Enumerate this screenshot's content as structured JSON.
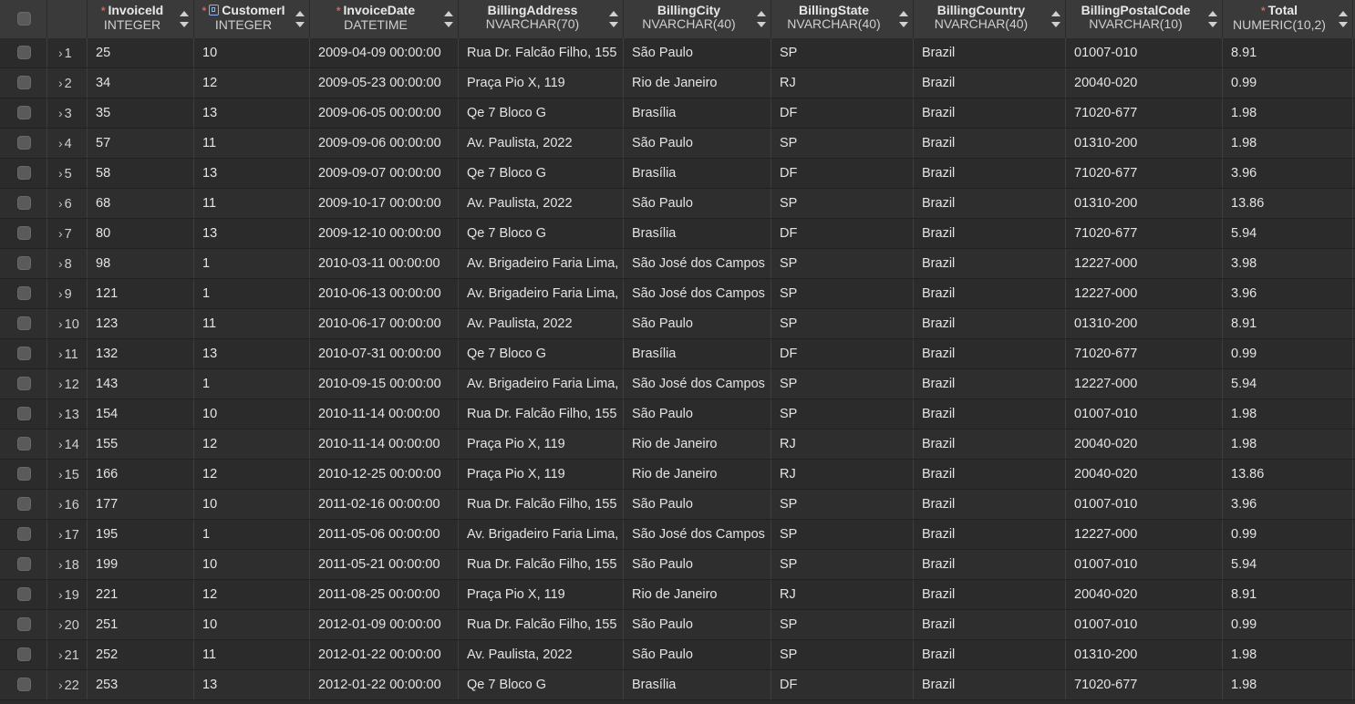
{
  "columns": [
    {
      "name": "InvoiceId",
      "type": "INTEGER",
      "required": true,
      "key": false
    },
    {
      "name": "CustomerI",
      "type": "INTEGER",
      "required": true,
      "key": true
    },
    {
      "name": "InvoiceDate",
      "type": "DATETIME",
      "required": true,
      "key": false
    },
    {
      "name": "BillingAddress",
      "type": "NVARCHAR(70)",
      "required": false,
      "key": false
    },
    {
      "name": "BillingCity",
      "type": "NVARCHAR(40)",
      "required": false,
      "key": false
    },
    {
      "name": "BillingState",
      "type": "NVARCHAR(40)",
      "required": false,
      "key": false
    },
    {
      "name": "BillingCountry",
      "type": "NVARCHAR(40)",
      "required": false,
      "key": false
    },
    {
      "name": "BillingPostalCode",
      "type": "NVARCHAR(10)",
      "required": false,
      "key": false
    },
    {
      "name": "Total",
      "type": "NUMERIC(10,2)",
      "required": true,
      "key": false
    }
  ],
  "required_marker": "*",
  "rows": [
    {
      "num": "1",
      "values": [
        "25",
        "10",
        "2009-04-09 00:00:00",
        "Rua Dr. Falcão Filho, 155",
        "São Paulo",
        "SP",
        "Brazil",
        "01007-010",
        "8.91"
      ]
    },
    {
      "num": "2",
      "values": [
        "34",
        "12",
        "2009-05-23 00:00:00",
        "Praça Pio X, 119",
        "Rio de Janeiro",
        "RJ",
        "Brazil",
        "20040-020",
        "0.99"
      ]
    },
    {
      "num": "3",
      "values": [
        "35",
        "13",
        "2009-06-05 00:00:00",
        "Qe 7 Bloco G",
        "Brasília",
        "DF",
        "Brazil",
        "71020-677",
        "1.98"
      ]
    },
    {
      "num": "4",
      "values": [
        "57",
        "11",
        "2009-09-06 00:00:00",
        "Av. Paulista, 2022",
        "São Paulo",
        "SP",
        "Brazil",
        "01310-200",
        "1.98"
      ]
    },
    {
      "num": "5",
      "values": [
        "58",
        "13",
        "2009-09-07 00:00:00",
        "Qe 7 Bloco G",
        "Brasília",
        "DF",
        "Brazil",
        "71020-677",
        "3.96"
      ]
    },
    {
      "num": "6",
      "values": [
        "68",
        "11",
        "2009-10-17 00:00:00",
        "Av. Paulista, 2022",
        "São Paulo",
        "SP",
        "Brazil",
        "01310-200",
        "13.86"
      ]
    },
    {
      "num": "7",
      "values": [
        "80",
        "13",
        "2009-12-10 00:00:00",
        "Qe 7 Bloco G",
        "Brasília",
        "DF",
        "Brazil",
        "71020-677",
        "5.94"
      ]
    },
    {
      "num": "8",
      "values": [
        "98",
        "1",
        "2010-03-11 00:00:00",
        "Av. Brigadeiro Faria Lima,",
        "São José dos Campos",
        "SP",
        "Brazil",
        "12227-000",
        "3.98"
      ]
    },
    {
      "num": "9",
      "values": [
        "121",
        "1",
        "2010-06-13 00:00:00",
        "Av. Brigadeiro Faria Lima,",
        "São José dos Campos",
        "SP",
        "Brazil",
        "12227-000",
        "3.96"
      ]
    },
    {
      "num": "10",
      "values": [
        "123",
        "11",
        "2010-06-17 00:00:00",
        "Av. Paulista, 2022",
        "São Paulo",
        "SP",
        "Brazil",
        "01310-200",
        "8.91"
      ]
    },
    {
      "num": "11",
      "values": [
        "132",
        "13",
        "2010-07-31 00:00:00",
        "Qe 7 Bloco G",
        "Brasília",
        "DF",
        "Brazil",
        "71020-677",
        "0.99"
      ]
    },
    {
      "num": "12",
      "values": [
        "143",
        "1",
        "2010-09-15 00:00:00",
        "Av. Brigadeiro Faria Lima,",
        "São José dos Campos",
        "SP",
        "Brazil",
        "12227-000",
        "5.94"
      ]
    },
    {
      "num": "13",
      "values": [
        "154",
        "10",
        "2010-11-14 00:00:00",
        "Rua Dr. Falcão Filho, 155",
        "São Paulo",
        "SP",
        "Brazil",
        "01007-010",
        "1.98"
      ]
    },
    {
      "num": "14",
      "values": [
        "155",
        "12",
        "2010-11-14 00:00:00",
        "Praça Pio X, 119",
        "Rio de Janeiro",
        "RJ",
        "Brazil",
        "20040-020",
        "1.98"
      ]
    },
    {
      "num": "15",
      "values": [
        "166",
        "12",
        "2010-12-25 00:00:00",
        "Praça Pio X, 119",
        "Rio de Janeiro",
        "RJ",
        "Brazil",
        "20040-020",
        "13.86"
      ]
    },
    {
      "num": "16",
      "values": [
        "177",
        "10",
        "2011-02-16 00:00:00",
        "Rua Dr. Falcão Filho, 155",
        "São Paulo",
        "SP",
        "Brazil",
        "01007-010",
        "3.96"
      ]
    },
    {
      "num": "17",
      "values": [
        "195",
        "1",
        "2011-05-06 00:00:00",
        "Av. Brigadeiro Faria Lima,",
        "São José dos Campos",
        "SP",
        "Brazil",
        "12227-000",
        "0.99"
      ]
    },
    {
      "num": "18",
      "values": [
        "199",
        "10",
        "2011-05-21 00:00:00",
        "Rua Dr. Falcão Filho, 155",
        "São Paulo",
        "SP",
        "Brazil",
        "01007-010",
        "5.94"
      ]
    },
    {
      "num": "19",
      "values": [
        "221",
        "12",
        "2011-08-25 00:00:00",
        "Praça Pio X, 119",
        "Rio de Janeiro",
        "RJ",
        "Brazil",
        "20040-020",
        "8.91"
      ]
    },
    {
      "num": "20",
      "values": [
        "251",
        "10",
        "2012-01-09 00:00:00",
        "Rua Dr. Falcão Filho, 155",
        "São Paulo",
        "SP",
        "Brazil",
        "01007-010",
        "0.99"
      ]
    },
    {
      "num": "21",
      "values": [
        "252",
        "11",
        "2012-01-22 00:00:00",
        "Av. Paulista, 2022",
        "São Paulo",
        "SP",
        "Brazil",
        "01310-200",
        "1.98"
      ]
    },
    {
      "num": "22",
      "values": [
        "253",
        "13",
        "2012-01-22 00:00:00",
        "Qe 7 Bloco G",
        "Brasília",
        "DF",
        "Brazil",
        "71020-677",
        "1.98"
      ]
    }
  ],
  "colors": {
    "background": "#2b2b2b",
    "header_background": "#3a3a3a",
    "required_marker": "#e0605a",
    "text": "#e4e4e4"
  },
  "icons": {
    "search": "magnifier-icon",
    "expand": "chevron-right-icon",
    "sort": "sort-arrows-icon",
    "key": "foreign-key-icon"
  }
}
